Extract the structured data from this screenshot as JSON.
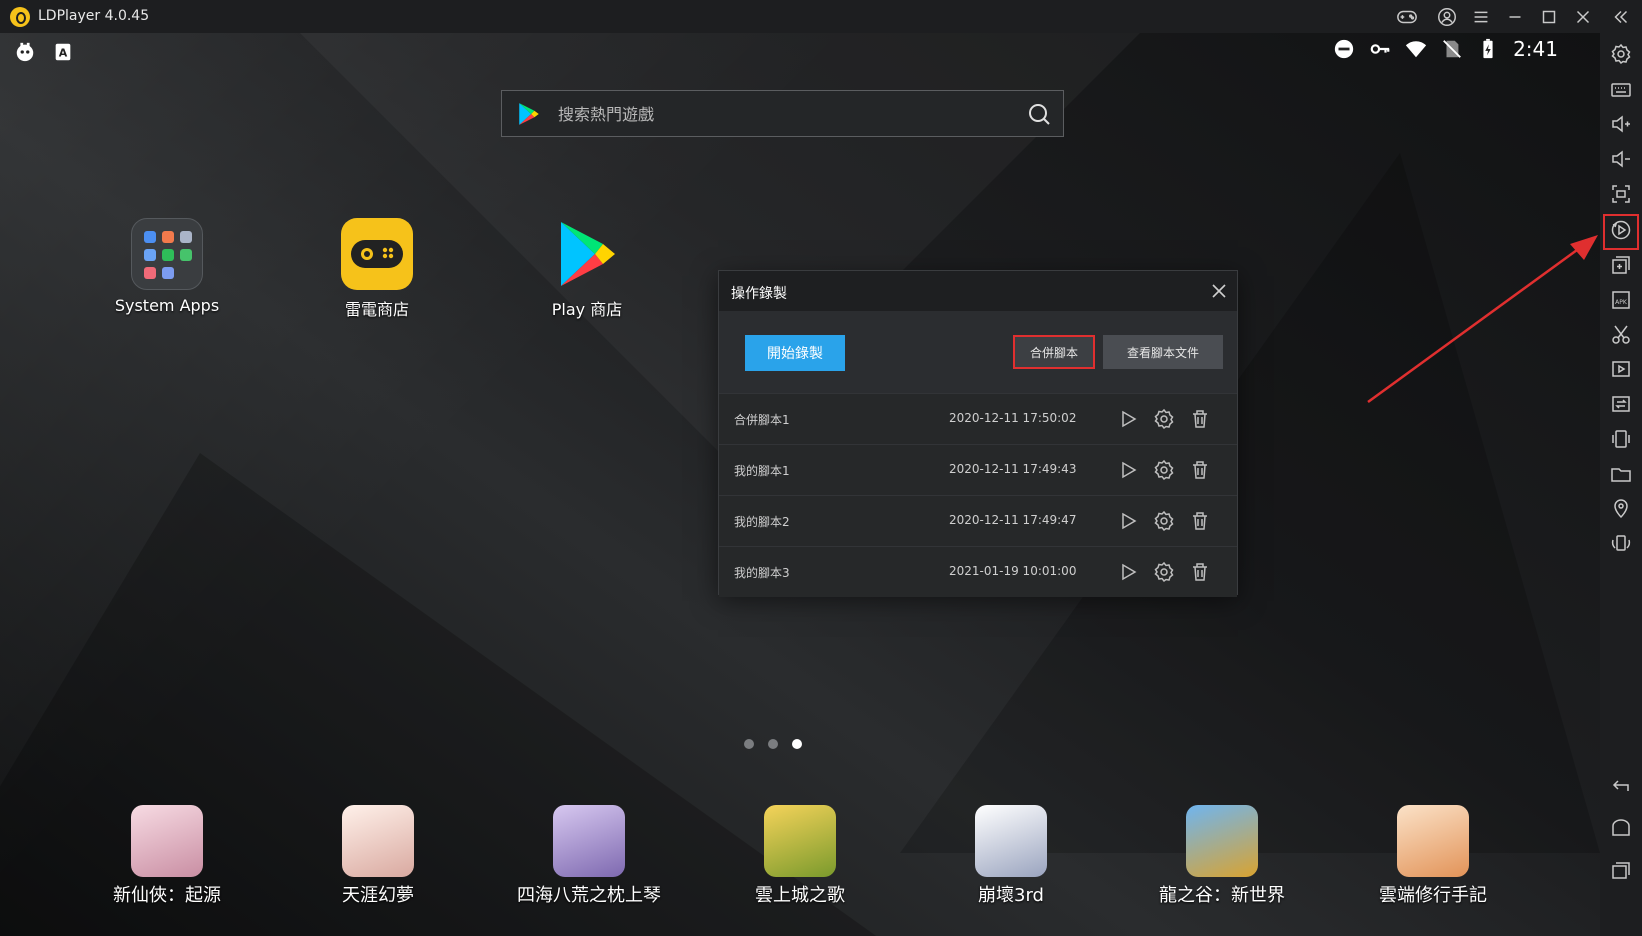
{
  "titlebar": {
    "title": "LDPlayer 4.0.45"
  },
  "status_bar": {
    "time": "2:41"
  },
  "search": {
    "placeholder": "搜索熱門遊戲"
  },
  "desktop_apps": [
    {
      "label": "System Apps"
    },
    {
      "label": "雷電商店"
    },
    {
      "label": "Play 商店"
    }
  ],
  "dialog": {
    "title": "操作錄製",
    "record_button": "開始錄製",
    "merge_button": "合併腳本",
    "view_files_button": "查看腳本文件",
    "scripts": [
      {
        "name": "合併腳本1",
        "time": "2020-12-11 17:50:02"
      },
      {
        "name": "我的腳本1",
        "time": "2020-12-11 17:49:43"
      },
      {
        "name": "我的腳本2",
        "time": "2020-12-11 17:49:47"
      },
      {
        "name": "我的腳本3",
        "time": "2021-01-19 10:01:00"
      }
    ]
  },
  "pager": {
    "pages": 3,
    "active_page": 3
  },
  "dock_apps": [
    {
      "label": "新仙俠：起源",
      "color": "#e9b8c4"
    },
    {
      "label": "天涯幻夢",
      "color": "#f3d9d2"
    },
    {
      "label": "四海八荒之枕上琴",
      "color": "#b9a6d8"
    },
    {
      "label": "雲上城之歌",
      "color": "#e0b03a"
    },
    {
      "label": "崩壞3rd",
      "color": "#dfe3ee"
    },
    {
      "label": "龍之谷：新世界",
      "color": "#3a7fc9"
    },
    {
      "label": "雲端修行手記",
      "color": "#f0b88a"
    }
  ],
  "colors": {
    "accent_blue": "#2aa3ea",
    "highlight_red": "#e02f2f",
    "leidian_yellow": "#f6c21a"
  }
}
